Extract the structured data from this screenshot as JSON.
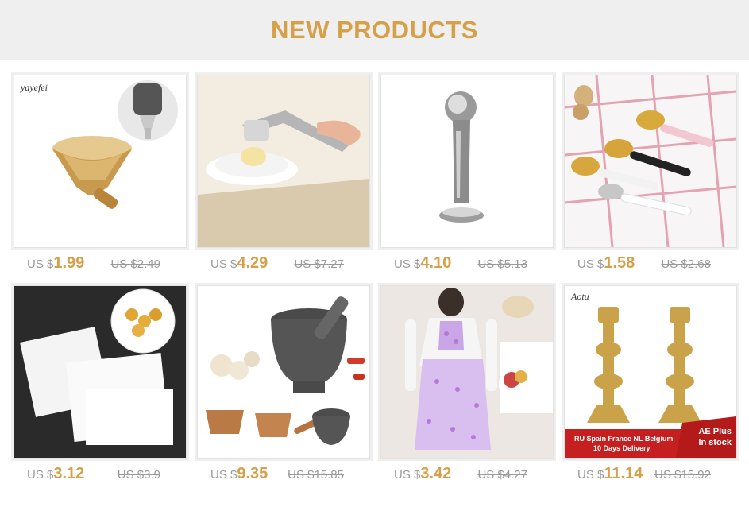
{
  "header": {
    "title": "NEW PRODUCTS"
  },
  "products": [
    {
      "currency": "US $",
      "price": "1.99",
      "old_price": "US $2.49",
      "image_label": "yayefei"
    },
    {
      "currency": "US $",
      "price": "4.29",
      "old_price": "US $7.27"
    },
    {
      "currency": "US $",
      "price": "4.10",
      "old_price": "US $5.13"
    },
    {
      "currency": "US $",
      "price": "1.58",
      "old_price": "US $2.68"
    },
    {
      "currency": "US $",
      "price": "3.12",
      "old_price": "US $3.9"
    },
    {
      "currency": "US $",
      "price": "9.35",
      "old_price": "US $15.85"
    },
    {
      "currency": "US $",
      "price": "3.42",
      "old_price": "US $4.27"
    },
    {
      "currency": "US $",
      "price": "11.14",
      "old_price": "US $15.92",
      "image_label": "Aotu",
      "banner_line1": "RU Spain France NL Belgium",
      "banner_line2": "10 Days Delivery",
      "badge_line1": "AE Plus",
      "badge_line2": "In stock"
    }
  ]
}
